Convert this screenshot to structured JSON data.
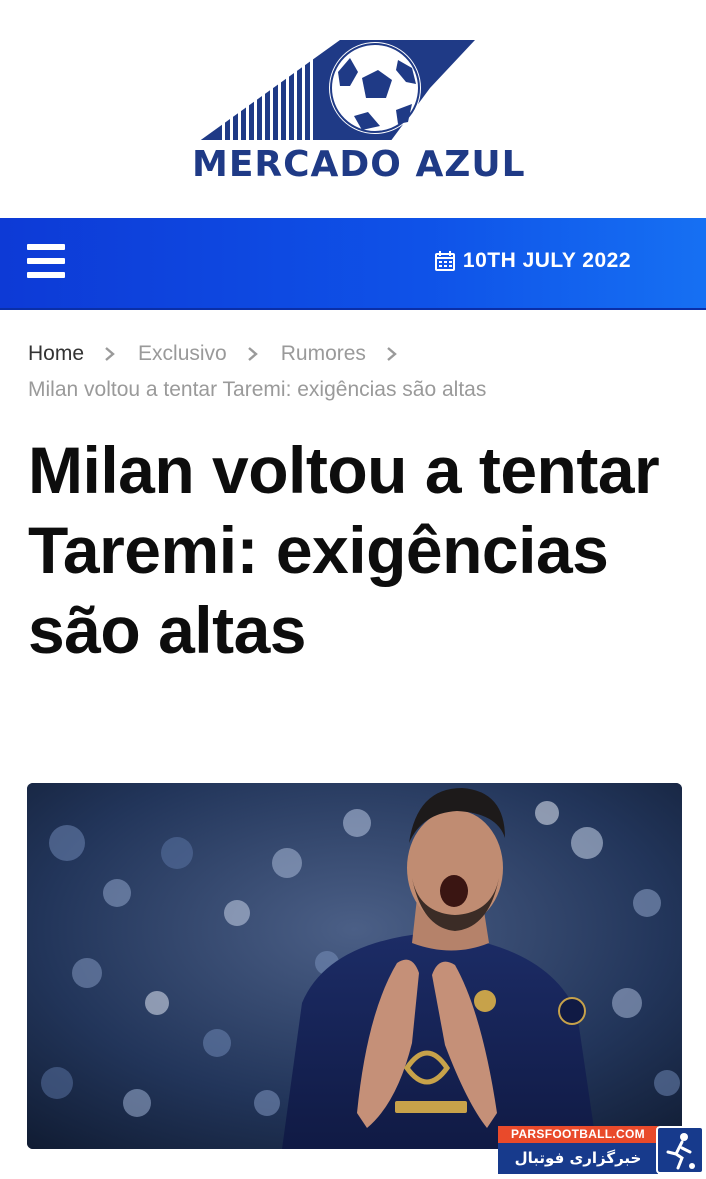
{
  "site": {
    "logo_text": "MERCADO AZUL",
    "logo_icon": "football-stadium-logo"
  },
  "navbar": {
    "menu_icon": "hamburger-menu-icon",
    "calendar_icon": "calendar-icon",
    "date": "10TH JULY 2022"
  },
  "breadcrumb": {
    "items": [
      "Home",
      "Exclusivo",
      "Rumores"
    ],
    "current": "Milan voltou a tentar Taremi: exigências são altas",
    "separator_icon": "chevron-right-icon"
  },
  "article": {
    "title": "Milan voltou a tentar Taremi: exigências são altas",
    "hero_image_alt": "player-photo"
  },
  "watermark": {
    "top": "PARSFOOTBALL.COM",
    "bottom": "خبرگزاری فوتبال ایران"
  },
  "colors": {
    "nav_blue": "#0f52e8",
    "logo_blue": "#1f3a86",
    "breadcrumb_gray": "#9a9a9a",
    "title_black": "#0d0d0d",
    "watermark_red": "#e94a2b",
    "watermark_blue": "#173a8c"
  }
}
